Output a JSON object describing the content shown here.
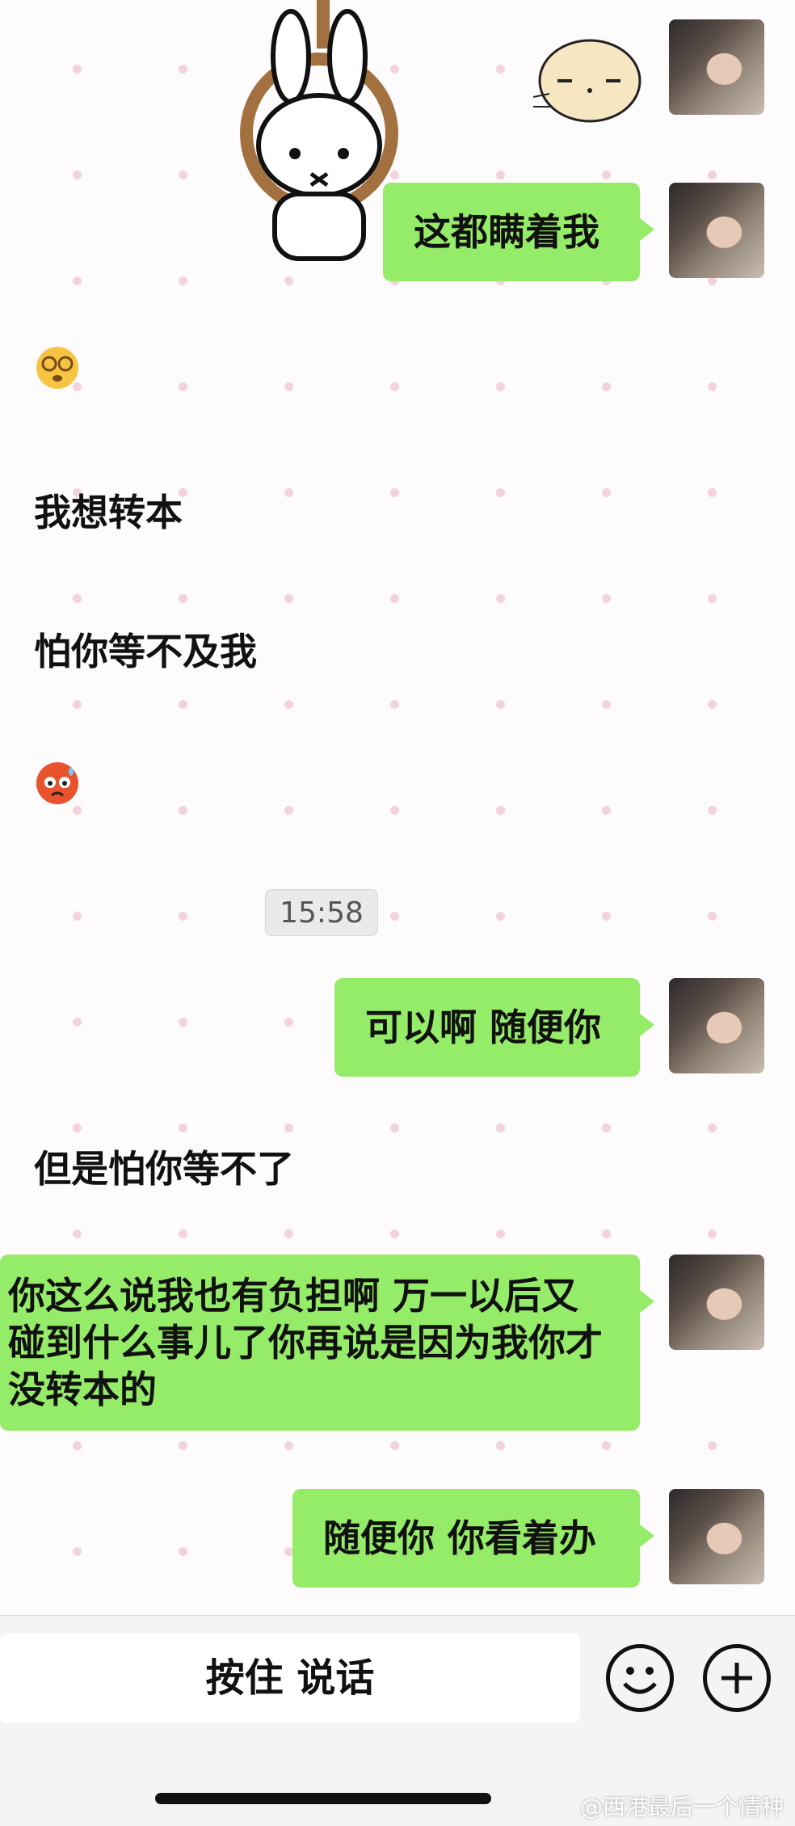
{
  "messages": {
    "m1": "这都瞒着我",
    "m2": "我想转本",
    "m3": "怕你等不及我",
    "m4": "可以啊 随便你",
    "m5": "但是怕你等不了",
    "m6": "你这么说我也有负担啊 万一以后又碰到什么事儿了你再说是因为我你才没转本的",
    "m7": "随便你 你看着办"
  },
  "timestamp": "15:58",
  "input": {
    "hold_to_talk": "按住 说话"
  },
  "icons": {
    "sticker_rabbit": "miffy-noose-sticker",
    "sticker_cat": "round-cat-sticker",
    "emoji_dizzy": "dizzy-face",
    "emoji_sweat": "angry-sweat-face",
    "emoji_button": "smiley-icon",
    "plus_button": "plus-icon"
  },
  "watermark": "@西港最后一个情种"
}
